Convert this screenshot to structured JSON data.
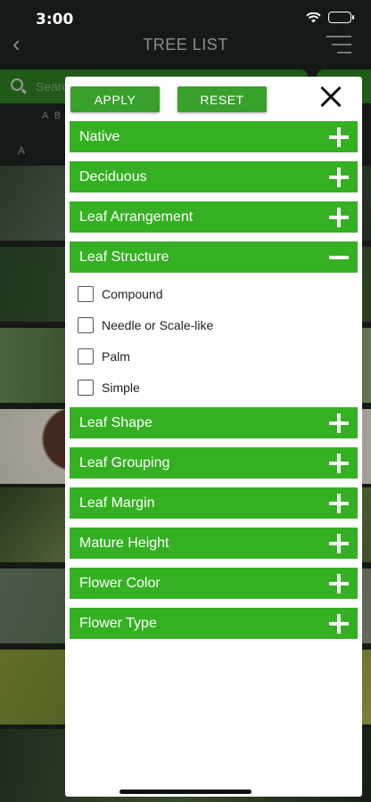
{
  "status_bar": {
    "time": "3:00"
  },
  "nav": {
    "title": "TREE LIST"
  },
  "search": {
    "placeholder": "Search"
  },
  "alphabet_row": "A B",
  "list_section_letter": "A",
  "filter_panel": {
    "apply_label": "APPLY",
    "reset_label": "RESET",
    "sections": [
      {
        "label": "Native",
        "expanded": false
      },
      {
        "label": "Deciduous",
        "expanded": false
      },
      {
        "label": "Leaf Arrangement",
        "expanded": false
      },
      {
        "label": "Leaf Structure",
        "expanded": true,
        "options": [
          "Compound",
          "Needle or Scale-like",
          "Palm",
          "Simple"
        ]
      },
      {
        "label": "Leaf Shape",
        "expanded": false
      },
      {
        "label": "Leaf Grouping",
        "expanded": false
      },
      {
        "label": "Leaf Margin",
        "expanded": false
      },
      {
        "label": "Mature Height",
        "expanded": false
      },
      {
        "label": "Flower Color",
        "expanded": false
      },
      {
        "label": "Flower Type",
        "expanded": false
      }
    ]
  },
  "colors": {
    "accent_green": "#35b023",
    "button_green": "#3aa02c",
    "panel_bg": "#ffffff"
  }
}
